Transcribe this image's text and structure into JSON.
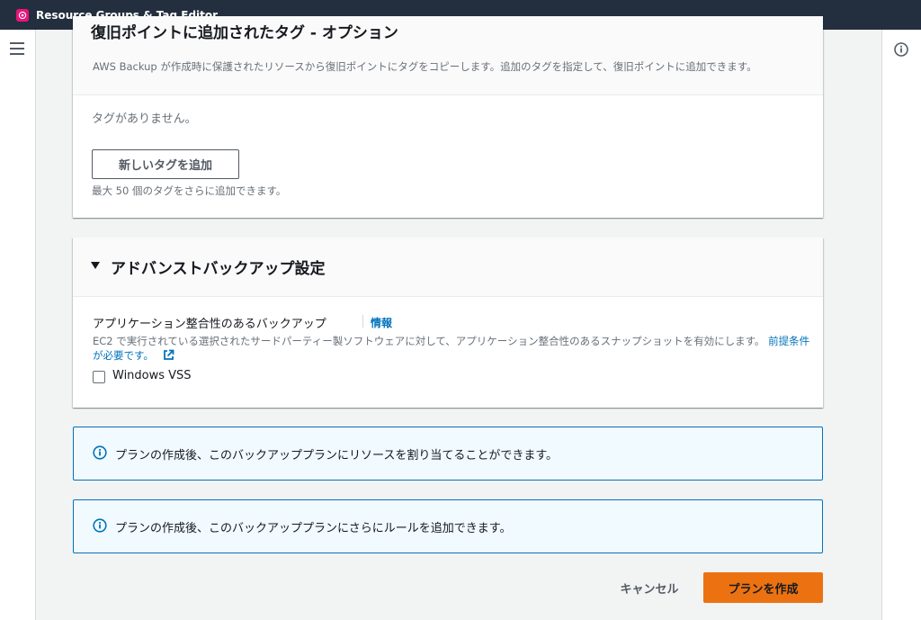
{
  "app": {
    "title": "Resource Groups & Tag Editor",
    "logo_color": "#e7157b",
    "topbar_color": "#232f3e"
  },
  "icons": {
    "menu": "hamburger-menu-icon",
    "help": "info-circle-icon",
    "external": "external-link-icon",
    "caret": "caret-down-icon"
  },
  "tags_section": {
    "title": "復旧ポイントに追加されたタグ - オプション",
    "description": "AWS Backup が作成時に保護されたリソースから復旧ポイントにタグをコピーします。追加のタグを指定して、復旧ポイントに追加できます。",
    "empty_text": "タグがありません。",
    "add_button": "新しいタグを追加",
    "limit_text": "最大 50 個のタグをさらに追加できます。"
  },
  "advanced_section": {
    "title": "アドバンストバックアップ設定",
    "app_consistent_label": "アプリケーション整合性のあるバックアップ",
    "info_link": "情報",
    "description": "EC2 で実行されている選択されたサードパーティー製ソフトウェアに対して、アプリケーション整合性のあるスナップショットを有効にします。",
    "prereq_link": "前提条件が必要です。",
    "checkbox_label": "Windows VSS",
    "checkbox_checked": false
  },
  "alerts": [
    {
      "text": "プランの作成後、このバックアッププランにリソースを割り当てることができます。"
    },
    {
      "text": "プランの作成後、このバックアッププランにさらにルールを追加できます。"
    }
  ],
  "actions": {
    "cancel": "キャンセル",
    "create": "プランを作成",
    "primary_color": "#ec7211",
    "link_color": "#0073bb"
  }
}
